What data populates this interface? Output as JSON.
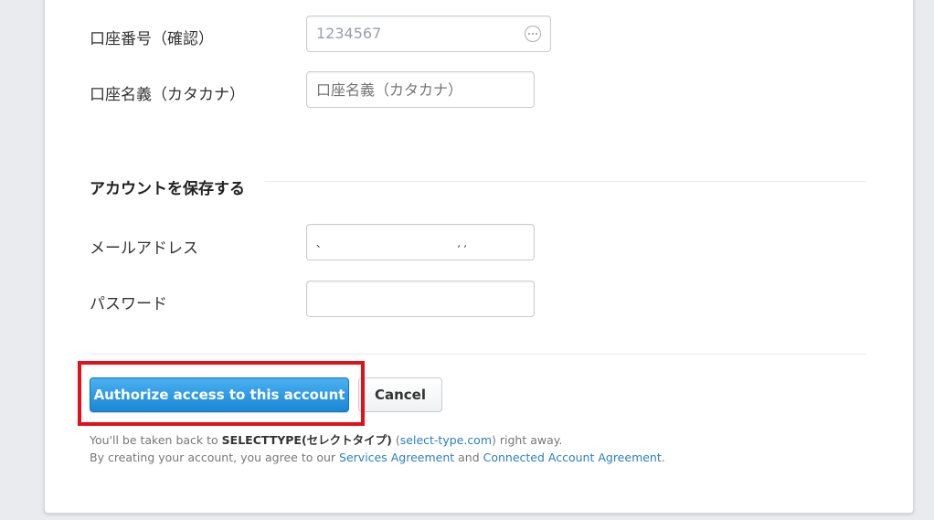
{
  "bank": {
    "account_number_confirm": {
      "label": "口座番号（確認）",
      "value": "1234567",
      "icon": "more-dots-icon"
    },
    "account_holder": {
      "label": "口座名義（カタカナ）",
      "placeholder": "口座名義（カタカナ）"
    }
  },
  "save_account": {
    "title": "アカウントを保存する",
    "email": {
      "label": "メールアドレス",
      "value": "、                                         , ,"
    },
    "password": {
      "label": "パスワード",
      "value": ""
    }
  },
  "actions": {
    "authorize_label": "Authorize access to this account",
    "cancel_label": "Cancel"
  },
  "footer": {
    "line1_prefix": "You'll be taken back to ",
    "line1_brand": "SELECTTYPE(セレクトタイプ)",
    "line1_open": " (",
    "line1_link": "select-type.com",
    "line1_close": ") right away.",
    "line2_prefix": "By creating your account, you agree to our ",
    "line2_link1": "Services Agreement",
    "line2_mid": " and ",
    "line2_link2": "Connected Account Agreement",
    "line2_end": "."
  },
  "colors": {
    "primary": "#1a86d6",
    "highlight": "#e3101a",
    "link": "#2a7fc4"
  }
}
